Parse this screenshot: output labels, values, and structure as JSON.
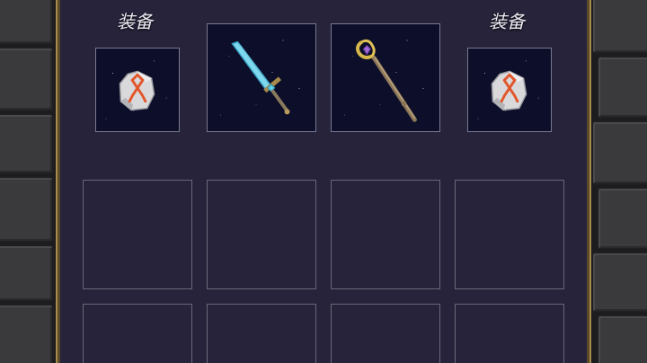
{
  "equipment": {
    "left_label": "装备",
    "right_label": "装备",
    "slots": [
      {
        "item": "rune-stone",
        "rune_color": "#e2562b"
      },
      {
        "item": "crystal-sword"
      },
      {
        "item": "magic-staff"
      },
      {
        "item": "rune-stone",
        "rune_color": "#e2562b"
      }
    ]
  },
  "inventory": {
    "rows": 2,
    "columns": 4,
    "slots_filled": 0
  },
  "colors": {
    "panel": "#26233a",
    "gold_trim": "#a88a4c",
    "slot_border": "#6a6878",
    "slot_background": "#0d0f2a"
  }
}
